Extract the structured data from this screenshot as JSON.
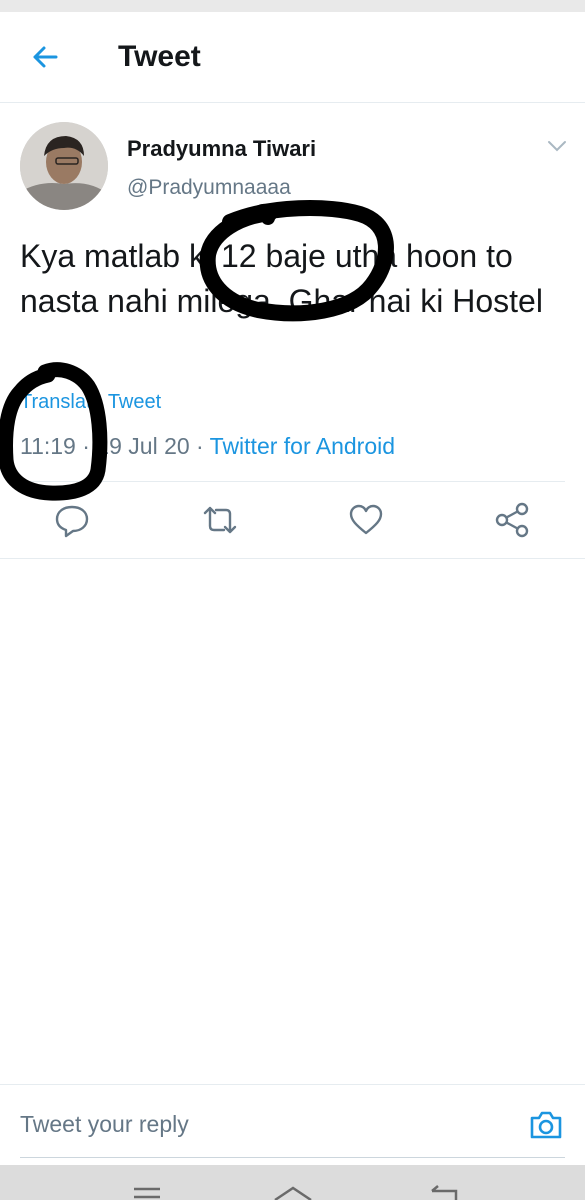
{
  "header": {
    "title": "Tweet",
    "back_icon": "arrow-left-icon"
  },
  "tweet": {
    "author_name": "Pradyumna Tiwari",
    "author_handle": "@Pradyumnaaaa",
    "text": "Kya matlab ki 12 baje utha hoon to nasta nahi milega, Ghar hai ki Hostel",
    "translate_label": "Translate Tweet",
    "time": "11:19",
    "date": " · 19 Jul 20 · ",
    "source": "Twitter for Android"
  },
  "actions": {
    "reply_icon": "reply-icon",
    "retweet_icon": "retweet-icon",
    "like_icon": "heart-icon",
    "share_icon": "share-icon"
  },
  "reply": {
    "placeholder": "Tweet your reply",
    "camera_icon": "camera-icon"
  },
  "colors": {
    "accent": "#1b95e0",
    "text": "#14171a",
    "muted": "#657786",
    "border": "#e6ecf0"
  }
}
